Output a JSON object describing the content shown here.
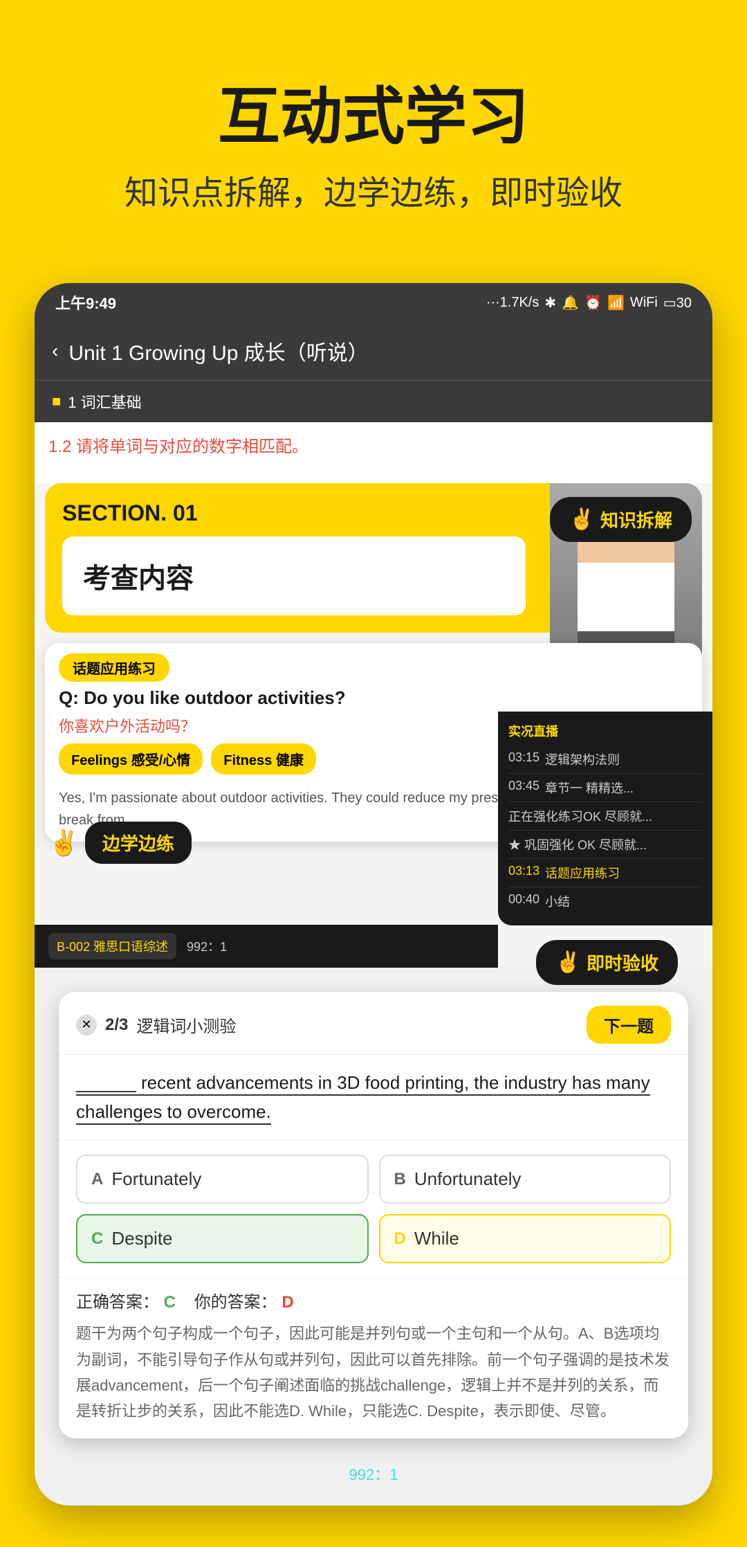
{
  "page": {
    "background_color": "#FFD700",
    "main_title": "互动式学习",
    "sub_title": "知识点拆解，边学边练，即时验收"
  },
  "status_bar": {
    "time": "上午9:49",
    "network": "···1.7K/s",
    "bluetooth": "⚡",
    "notifications": "🔔",
    "alarm": "⏰",
    "signal1": "📶",
    "signal2": "📶",
    "wifi": "WiFi",
    "battery": "30"
  },
  "nav": {
    "back_icon": "‹",
    "title": "Unit 1  Growing Up 成长（听说）"
  },
  "section_header": {
    "label": "1 词汇基础"
  },
  "vocab_section": {
    "label": "1.2",
    "instruction": "请将单词与对应的数字相匹配。"
  },
  "section_card": {
    "label": "SECTION. 01",
    "content": "考查内容"
  },
  "tooltips": {
    "knowledge": "知识拆解",
    "practice": "边学边练",
    "verify": "即时验收"
  },
  "qa_section": {
    "tag": "话题应用练习",
    "question_en": "Q: Do you like outdoor activities?",
    "question_cn": "你喜欢户外活动吗？",
    "option1": "Feelings 感受/心情",
    "option2": "Fitness 健康",
    "answer_text": "Yes, I'm passionate about outdoor activities. They could reduce my pressure so that I can take a short break from..."
  },
  "quiz": {
    "close_icon": "✕",
    "progress": "2/3",
    "label": "逻辑词小测验",
    "next_btn": "下一题",
    "question_prefix": "______",
    "question": " recent advancements in 3D food printing, the industry has many challenges to overcome.",
    "options": [
      {
        "letter": "A",
        "text": "Fortunately",
        "state": "normal"
      },
      {
        "letter": "B",
        "text": "Unfortunately",
        "state": "normal"
      },
      {
        "letter": "C",
        "text": "Despite",
        "state": "correct"
      },
      {
        "letter": "D",
        "text": "While",
        "state": "selected_wrong"
      }
    ],
    "answer_label": "正确答案：",
    "correct_answer": "C",
    "your_answer_label": "你的答案：",
    "your_answer": "D",
    "explanation": "题干为两个句子构成一个句子，因此可能是并列句或一个主句和一个从句。A、B选项均为副词，不能引导句子作从句或并列句，因此可以首先排除。前一个句子强调的是技术发展advancement，后一个句子阐述面临的挑战challenge，逻辑上并不是并列的关系，而是转折让步的关系，因此不能选D. While，只能选C. Despite，表示即使、尽管。"
  },
  "bottom_strip": {
    "course_id": "B-002 雅思口语综述",
    "count": "992：1"
  },
  "dark_panel": {
    "title": "实况直播",
    "rows": [
      {
        "time": "03:15",
        "text": "逻辑架构法则"
      },
      {
        "time": "03:45",
        "text": "章节一 精精选..."
      },
      {
        "time": "",
        "text": "正在强化练习OK 尽顾就..."
      },
      {
        "time": "",
        "text": "★ 巩固强化 OK 尽顾就..."
      },
      {
        "time": "03:13",
        "text": "话题应用练习"
      },
      {
        "time": "00:40",
        "text": "小结"
      }
    ]
  }
}
